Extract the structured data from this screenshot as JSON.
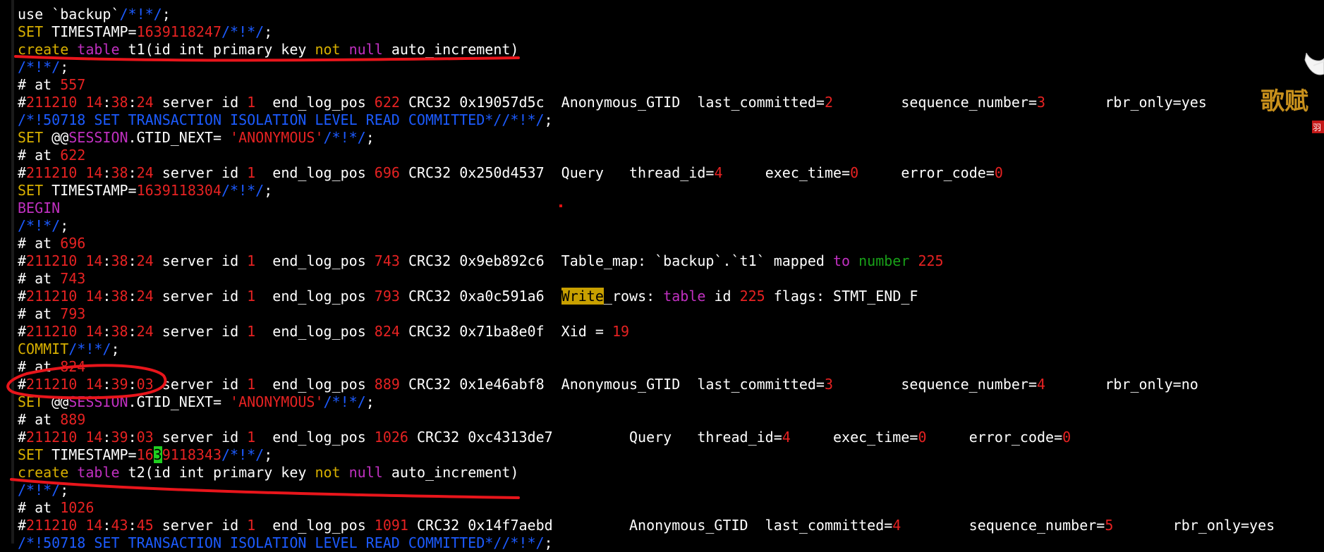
{
  "lines": [
    [
      {
        "t": "use `backup`",
        "c": "w"
      },
      {
        "t": "/*!*/",
        "c": "b"
      },
      {
        "t": ";",
        "c": "w"
      }
    ],
    [
      {
        "t": "SET",
        "c": "y"
      },
      {
        "t": " TIMESTAMP=",
        "c": "w"
      },
      {
        "t": "1639118247",
        "c": "r"
      },
      {
        "t": "/*!*/",
        "c": "b"
      },
      {
        "t": ";",
        "c": "w"
      }
    ],
    [
      {
        "t": "create",
        "c": "y"
      },
      {
        "t": " ",
        "c": "w"
      },
      {
        "t": "table",
        "c": "m"
      },
      {
        "t": " t1(id int primary key ",
        "c": "w"
      },
      {
        "t": "not",
        "c": "y"
      },
      {
        "t": " ",
        "c": "w"
      },
      {
        "t": "null",
        "c": "m"
      },
      {
        "t": " auto_increment)",
        "c": "w"
      }
    ],
    [
      {
        "t": "/*!*/",
        "c": "b"
      },
      {
        "t": ";",
        "c": "w"
      }
    ],
    [
      {
        "t": "# at ",
        "c": "w"
      },
      {
        "t": "557",
        "c": "r"
      }
    ],
    [
      {
        "t": "#",
        "c": "w"
      },
      {
        "t": "211210 14",
        "c": "r"
      },
      {
        "t": ":",
        "c": "w"
      },
      {
        "t": "38",
        "c": "r"
      },
      {
        "t": ":",
        "c": "w"
      },
      {
        "t": "24",
        "c": "r"
      },
      {
        "t": " server id ",
        "c": "w"
      },
      {
        "t": "1",
        "c": "r"
      },
      {
        "t": "  end_log_pos ",
        "c": "w"
      },
      {
        "t": "622",
        "c": "r"
      },
      {
        "t": " CRC32 0x19057d5c  Anonymous_GTID  last_committed=",
        "c": "w"
      },
      {
        "t": "2",
        "c": "r"
      },
      {
        "t": "        sequence_number=",
        "c": "w"
      },
      {
        "t": "3",
        "c": "r"
      },
      {
        "t": "       rbr_only=yes",
        "c": "w"
      }
    ],
    [
      {
        "t": "/*!50718 SET TRANSACTION ISOLATION LEVEL READ COMMITTED*//*!*/",
        "c": "b"
      },
      {
        "t": ";",
        "c": "w"
      }
    ],
    [
      {
        "t": "SET",
        "c": "y"
      },
      {
        "t": " @@",
        "c": "w"
      },
      {
        "t": "SESSION",
        "c": "m"
      },
      {
        "t": ".GTID_NEXT= ",
        "c": "w"
      },
      {
        "t": "'ANONYMOUS'",
        "c": "r"
      },
      {
        "t": "/*!*/",
        "c": "b"
      },
      {
        "t": ";",
        "c": "w"
      }
    ],
    [
      {
        "t": "# at ",
        "c": "w"
      },
      {
        "t": "622",
        "c": "r"
      }
    ],
    [
      {
        "t": "#",
        "c": "w"
      },
      {
        "t": "211210 14",
        "c": "r"
      },
      {
        "t": ":",
        "c": "w"
      },
      {
        "t": "38",
        "c": "r"
      },
      {
        "t": ":",
        "c": "w"
      },
      {
        "t": "24",
        "c": "r"
      },
      {
        "t": " server id ",
        "c": "w"
      },
      {
        "t": "1",
        "c": "r"
      },
      {
        "t": "  end_log_pos ",
        "c": "w"
      },
      {
        "t": "696",
        "c": "r"
      },
      {
        "t": " CRC32 0x250d4537  Query   thread_id=",
        "c": "w"
      },
      {
        "t": "4",
        "c": "r"
      },
      {
        "t": "     exec_time=",
        "c": "w"
      },
      {
        "t": "0",
        "c": "r"
      },
      {
        "t": "     error_code=",
        "c": "w"
      },
      {
        "t": "0",
        "c": "r"
      }
    ],
    [
      {
        "t": "SET",
        "c": "y"
      },
      {
        "t": " TIMESTAMP=",
        "c": "w"
      },
      {
        "t": "1639118304",
        "c": "r"
      },
      {
        "t": "/*!*/",
        "c": "b"
      },
      {
        "t": ";",
        "c": "w"
      }
    ],
    [
      {
        "t": "BEGIN",
        "c": "m"
      }
    ],
    [
      {
        "t": "/*!*/",
        "c": "b"
      },
      {
        "t": ";",
        "c": "w"
      }
    ],
    [
      {
        "t": "# at ",
        "c": "w"
      },
      {
        "t": "696",
        "c": "r"
      }
    ],
    [
      {
        "t": "#",
        "c": "w"
      },
      {
        "t": "211210 14",
        "c": "r"
      },
      {
        "t": ":",
        "c": "w"
      },
      {
        "t": "38",
        "c": "r"
      },
      {
        "t": ":",
        "c": "w"
      },
      {
        "t": "24",
        "c": "r"
      },
      {
        "t": " server id ",
        "c": "w"
      },
      {
        "t": "1",
        "c": "r"
      },
      {
        "t": "  end_log_pos ",
        "c": "w"
      },
      {
        "t": "743",
        "c": "r"
      },
      {
        "t": " CRC32 0x9eb892c6  Table_map: `backup`.`t1` mapped ",
        "c": "w"
      },
      {
        "t": "to",
        "c": "m"
      },
      {
        "t": " ",
        "c": "w"
      },
      {
        "t": "number",
        "c": "g"
      },
      {
        "t": " ",
        "c": "w"
      },
      {
        "t": "225",
        "c": "r"
      }
    ],
    [
      {
        "t": "# at ",
        "c": "w"
      },
      {
        "t": "743",
        "c": "r"
      }
    ],
    [
      {
        "t": "#",
        "c": "w"
      },
      {
        "t": "211210 14",
        "c": "r"
      },
      {
        "t": ":",
        "c": "w"
      },
      {
        "t": "38",
        "c": "r"
      },
      {
        "t": ":",
        "c": "w"
      },
      {
        "t": "24",
        "c": "r"
      },
      {
        "t": " server id ",
        "c": "w"
      },
      {
        "t": "1",
        "c": "r"
      },
      {
        "t": "  end_log_pos ",
        "c": "w"
      },
      {
        "t": "793",
        "c": "r"
      },
      {
        "t": " CRC32 0xa0c591a6  ",
        "c": "w"
      },
      {
        "t": "Write",
        "c": "hl-y"
      },
      {
        "t": "_rows: ",
        "c": "w"
      },
      {
        "t": "table",
        "c": "m"
      },
      {
        "t": " id ",
        "c": "w"
      },
      {
        "t": "225",
        "c": "r"
      },
      {
        "t": " flags: STMT_END_F",
        "c": "w"
      }
    ],
    [
      {
        "t": "# at ",
        "c": "w"
      },
      {
        "t": "793",
        "c": "r"
      }
    ],
    [
      {
        "t": "#",
        "c": "w"
      },
      {
        "t": "211210 14",
        "c": "r"
      },
      {
        "t": ":",
        "c": "w"
      },
      {
        "t": "38",
        "c": "r"
      },
      {
        "t": ":",
        "c": "w"
      },
      {
        "t": "24",
        "c": "r"
      },
      {
        "t": " server id ",
        "c": "w"
      },
      {
        "t": "1",
        "c": "r"
      },
      {
        "t": "  end_log_pos ",
        "c": "w"
      },
      {
        "t": "824",
        "c": "r"
      },
      {
        "t": " CRC32 0x71ba8e0f  Xid = ",
        "c": "w"
      },
      {
        "t": "19",
        "c": "r"
      }
    ],
    [
      {
        "t": "COMMIT",
        "c": "y"
      },
      {
        "t": "/*!*/",
        "c": "b"
      },
      {
        "t": ";",
        "c": "w"
      }
    ],
    [
      {
        "t": "# at ",
        "c": "w"
      },
      {
        "t": "824",
        "c": "r"
      }
    ],
    [
      {
        "t": "#",
        "c": "w"
      },
      {
        "t": "211210 14",
        "c": "r"
      },
      {
        "t": ":",
        "c": "w"
      },
      {
        "t": "39",
        "c": "r"
      },
      {
        "t": ":",
        "c": "w"
      },
      {
        "t": "03",
        "c": "r"
      },
      {
        "t": " server id ",
        "c": "w"
      },
      {
        "t": "1",
        "c": "r"
      },
      {
        "t": "  end_log_pos ",
        "c": "w"
      },
      {
        "t": "889",
        "c": "r"
      },
      {
        "t": " CRC32 0x1e46abf8  Anonymous_GTID  last_committed=",
        "c": "w"
      },
      {
        "t": "3",
        "c": "r"
      },
      {
        "t": "        sequence_number=",
        "c": "w"
      },
      {
        "t": "4",
        "c": "r"
      },
      {
        "t": "       rbr_only=no",
        "c": "w"
      }
    ],
    [
      {
        "t": "SET",
        "c": "y"
      },
      {
        "t": " @@",
        "c": "w"
      },
      {
        "t": "SESSION",
        "c": "m"
      },
      {
        "t": ".GTID_NEXT= ",
        "c": "w"
      },
      {
        "t": "'ANONYMOUS'",
        "c": "r"
      },
      {
        "t": "/*!*/",
        "c": "b"
      },
      {
        "t": ";",
        "c": "w"
      }
    ],
    [
      {
        "t": "# at ",
        "c": "w"
      },
      {
        "t": "889",
        "c": "r"
      }
    ],
    [
      {
        "t": "#",
        "c": "w"
      },
      {
        "t": "211210 14",
        "c": "r"
      },
      {
        "t": ":",
        "c": "w"
      },
      {
        "t": "39",
        "c": "r"
      },
      {
        "t": ":",
        "c": "w"
      },
      {
        "t": "03",
        "c": "r"
      },
      {
        "t": " server id ",
        "c": "w"
      },
      {
        "t": "1",
        "c": "r"
      },
      {
        "t": "  end_log_pos ",
        "c": "w"
      },
      {
        "t": "1026",
        "c": "r"
      },
      {
        "t": " CRC32 0xc4313de7         Query   thread_id=",
        "c": "w"
      },
      {
        "t": "4",
        "c": "r"
      },
      {
        "t": "     exec_time=",
        "c": "w"
      },
      {
        "t": "0",
        "c": "r"
      },
      {
        "t": "     error_code=",
        "c": "w"
      },
      {
        "t": "0",
        "c": "r"
      }
    ],
    [
      {
        "t": "SET",
        "c": "y"
      },
      {
        "t": " TIMESTAMP=",
        "c": "w"
      },
      {
        "t": "16",
        "c": "r"
      },
      {
        "t": "3",
        "c": "hl-g"
      },
      {
        "t": "9118343",
        "c": "r"
      },
      {
        "t": "/*!*/",
        "c": "b"
      },
      {
        "t": ";",
        "c": "w"
      }
    ],
    [
      {
        "t": "create",
        "c": "y"
      },
      {
        "t": " ",
        "c": "w"
      },
      {
        "t": "table",
        "c": "m"
      },
      {
        "t": " t2(id int primary key ",
        "c": "w"
      },
      {
        "t": "not",
        "c": "y"
      },
      {
        "t": " ",
        "c": "w"
      },
      {
        "t": "null",
        "c": "m"
      },
      {
        "t": " auto_increment)",
        "c": "w"
      }
    ],
    [
      {
        "t": "/*!*/",
        "c": "b"
      },
      {
        "t": ";",
        "c": "w"
      }
    ],
    [
      {
        "t": "# at ",
        "c": "w"
      },
      {
        "t": "1026",
        "c": "r"
      }
    ],
    [
      {
        "t": "#",
        "c": "w"
      },
      {
        "t": "211210 14",
        "c": "r"
      },
      {
        "t": ":",
        "c": "w"
      },
      {
        "t": "43",
        "c": "r"
      },
      {
        "t": ":",
        "c": "w"
      },
      {
        "t": "45",
        "c": "r"
      },
      {
        "t": " server id ",
        "c": "w"
      },
      {
        "t": "1",
        "c": "r"
      },
      {
        "t": "  end_log_pos ",
        "c": "w"
      },
      {
        "t": "1091",
        "c": "r"
      },
      {
        "t": " CRC32 0x14f7aebd         Anonymous_GTID  last_committed=",
        "c": "w"
      },
      {
        "t": "4",
        "c": "r"
      },
      {
        "t": "        sequence_number=",
        "c": "w"
      },
      {
        "t": "5",
        "c": "r"
      },
      {
        "t": "       rbr_only=yes",
        "c": "w"
      }
    ],
    [
      {
        "t": "/*!50718 SET TRANSACTION ISOLATION LEVEL READ COMMITTED*//*!*/",
        "c": "b"
      },
      {
        "t": ";",
        "c": "w"
      }
    ]
  ],
  "logo": {
    "text": "歌赋",
    "seal": "羽"
  },
  "colors": {
    "background": "#000000",
    "text": "#ffffff",
    "number": "#e62222",
    "comment": "#1c5bff",
    "keyword_yellow": "#d7af00",
    "keyword_magenta": "#c030c0",
    "keyword_green": "#18a018",
    "annotation": "#e8151b"
  }
}
